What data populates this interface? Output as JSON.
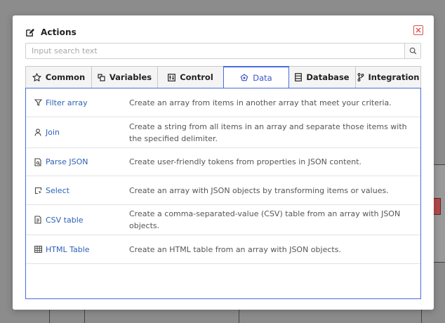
{
  "dialog": {
    "title": "Actions",
    "search_placeholder": "Input search text"
  },
  "tabs": [
    {
      "label": "Common",
      "icon": "star-icon"
    },
    {
      "label": "Variables",
      "icon": "variables-icon"
    },
    {
      "label": "Control",
      "icon": "control-icon"
    },
    {
      "label": "Data",
      "icon": "data-icon",
      "active": true
    },
    {
      "label": "Database",
      "icon": "database-icon"
    },
    {
      "label": "Integration",
      "icon": "integration-icon"
    }
  ],
  "actions": [
    {
      "name": "Filter array",
      "icon": "filter-icon",
      "description": "Create an array from items in another array that meet your criteria."
    },
    {
      "name": "Join",
      "icon": "join-icon",
      "description": "Create a string from all items in an array and separate those items with the specified delimiter."
    },
    {
      "name": "Parse JSON",
      "icon": "parse-json-icon",
      "description": "Create user-friendly tokens from properties in JSON content."
    },
    {
      "name": "Select",
      "icon": "select-icon",
      "description": "Create an array with JSON objects by transforming items or values."
    },
    {
      "name": "CSV table",
      "icon": "csv-icon",
      "description": "Create a comma-separated-value (CSV) table from an array with JSON objects."
    },
    {
      "name": "HTML Table",
      "icon": "table-icon",
      "description": "Create an HTML table from an array with JSON objects."
    }
  ],
  "colors": {
    "accent": "#4a6be0",
    "link": "#2d62b8",
    "close": "#d9534f"
  }
}
